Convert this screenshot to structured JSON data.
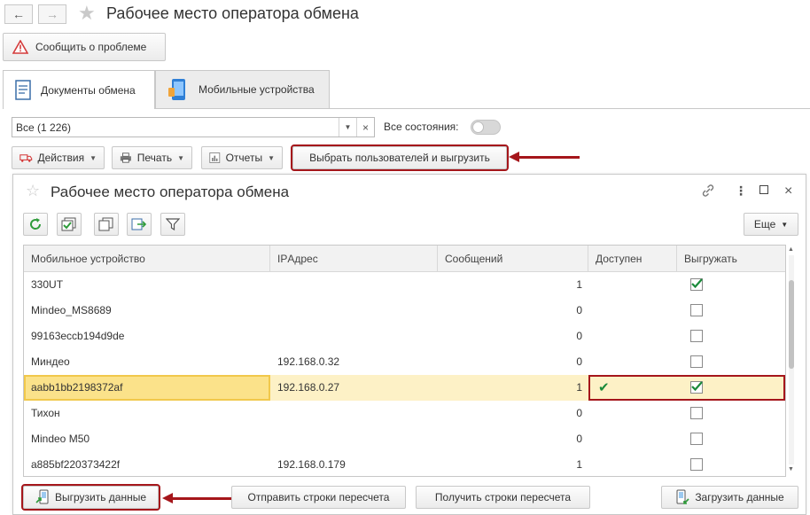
{
  "app": {
    "title": "Рабочее место оператора обмена",
    "report_button": "Сообщить о проблеме"
  },
  "tabs": [
    {
      "label": "Документы обмена",
      "icon": "document-icon",
      "active": true
    },
    {
      "label": "Мобильные устройства",
      "icon": "mobile-device-icon",
      "active": false
    }
  ],
  "filter": {
    "value": "Все (1 226)",
    "all_states_label": "Все состояния:",
    "all_states_on": false
  },
  "toolbar": {
    "actions": "Действия",
    "print": "Печать",
    "reports": "Отчеты",
    "select_users": "Выбрать пользователей и выгрузить"
  },
  "dialog": {
    "title": "Рабочее место оператора обмена",
    "more": "Еще",
    "icons": [
      "refresh-icon",
      "check-all-icon",
      "copy-icon",
      "export-icon",
      "filter-icon"
    ],
    "columns": [
      "Мобильное устройство",
      "IPАдрес",
      "Сообщений",
      "Доступен",
      "Выгружать"
    ],
    "rows": [
      {
        "device": "330UT",
        "ip": "",
        "messages": "1",
        "available": false,
        "export": true
      },
      {
        "device": "Mindeo_MS8689",
        "ip": "",
        "messages": "0",
        "available": false,
        "export": false
      },
      {
        "device": "99163eccb194d9de",
        "ip": "",
        "messages": "0",
        "available": false,
        "export": false
      },
      {
        "device": "Миндео",
        "ip": "192.168.0.32",
        "messages": "0",
        "available": false,
        "export": false
      },
      {
        "device": "aabb1bb2198372af",
        "ip": "192.168.0.27",
        "messages": "1",
        "available": true,
        "export": true,
        "selected": true
      },
      {
        "device": "Тихон",
        "ip": "",
        "messages": "0",
        "available": false,
        "export": false
      },
      {
        "device": "Mindeo M50",
        "ip": "",
        "messages": "0",
        "available": false,
        "export": false
      },
      {
        "device": "a885bf220373422f",
        "ip": "192.168.0.179",
        "messages": "1",
        "available": false,
        "export": false
      }
    ],
    "buttons": {
      "upload": "Выгрузить данные",
      "send_recalc": "Отправить строки пересчета",
      "get_recalc": "Получить строки пересчета",
      "download": "Загрузить данные"
    }
  },
  "colors": {
    "highlight": "#a5161b",
    "selected_row": "#fdf1c6",
    "check": "#1a8a3a"
  }
}
